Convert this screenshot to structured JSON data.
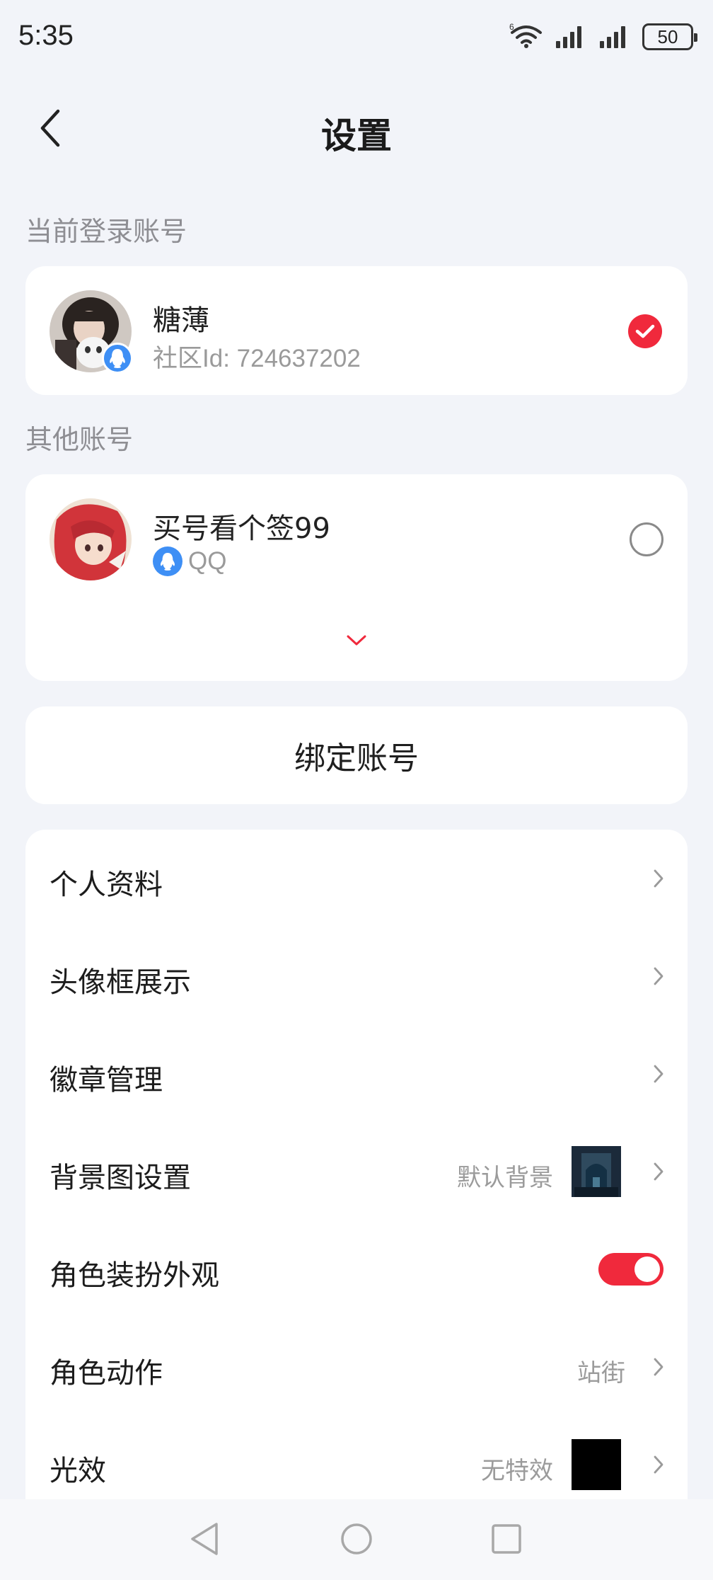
{
  "status_bar": {
    "time": "5:35",
    "battery": "50",
    "icons": [
      "wifi-icon",
      "signal-icon",
      "signal-icon",
      "battery-icon"
    ]
  },
  "header": {
    "title": "设置",
    "back_icon": "chevron-left-icon"
  },
  "current_account": {
    "section_label": "当前登录账号",
    "name": "糖薄",
    "community_id": "社区Id: 724637202",
    "selected": true
  },
  "other_accounts": {
    "section_label": "其他账号",
    "items": [
      {
        "name": "买号看个签99",
        "platform": "QQ",
        "selected": false
      }
    ],
    "expand_icon": "chevron-down-icon"
  },
  "bind_account": {
    "label": "绑定账号"
  },
  "menu": {
    "items": [
      {
        "label": "个人资料"
      },
      {
        "label": "头像框展示"
      },
      {
        "label": "徽章管理"
      },
      {
        "label": "背景图设置",
        "value": "默认背景"
      },
      {
        "label": "角色装扮外观",
        "toggle_on": true
      },
      {
        "label": "角色动作",
        "value": "站街"
      },
      {
        "label": "光效",
        "value": "无特效"
      }
    ]
  },
  "colors": {
    "accent": "#f0293c",
    "background": "#f2f4f9",
    "card": "#ffffff",
    "qq_blue": "#3e8ff5",
    "muted_text": "#9b9b9b"
  },
  "system_nav": [
    "back-triangle-icon",
    "home-circle-icon",
    "recents-square-icon"
  ]
}
